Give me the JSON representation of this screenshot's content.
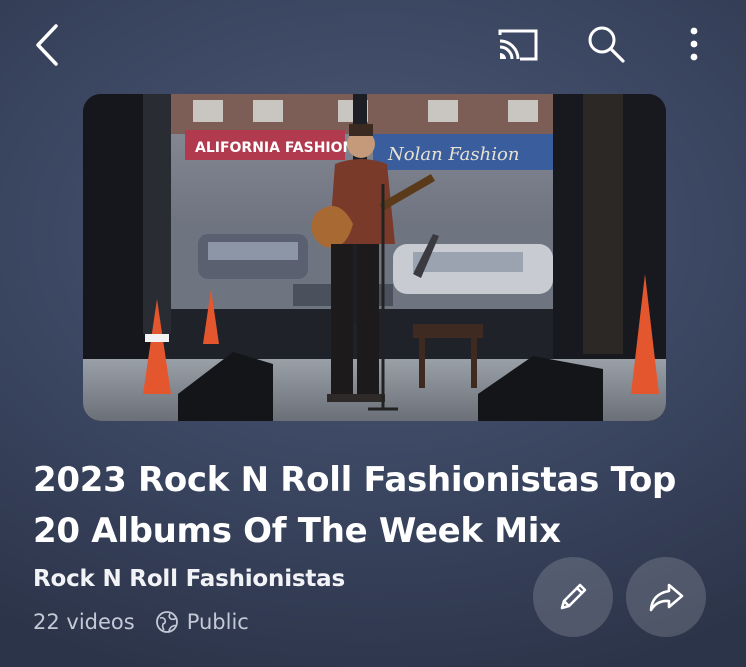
{
  "header": {
    "back_icon": "back-chevron-icon",
    "cast_icon": "cast-icon",
    "search_icon": "search-icon",
    "more_icon": "more-vertical-icon"
  },
  "thumbnail": {
    "description_icon": "video-thumbnail",
    "storefront_sign": "ALIFORNIA FASHION",
    "window_script": "Nolan Fashion"
  },
  "playlist": {
    "title": "2023 Rock N Roll Fashionistas Top 20 Albums Of The Week Mix",
    "channel": "Rock N Roll Fashionistas",
    "video_count": "22 videos",
    "visibility": "Public"
  },
  "actions": {
    "edit_icon": "pencil-icon",
    "share_icon": "share-arrow-icon"
  },
  "colors": {
    "background": "#3d4864",
    "text_primary": "#ffffff",
    "text_secondary": "#c4c9d6",
    "button_bg": "rgba(255,255,255,0.16)"
  }
}
